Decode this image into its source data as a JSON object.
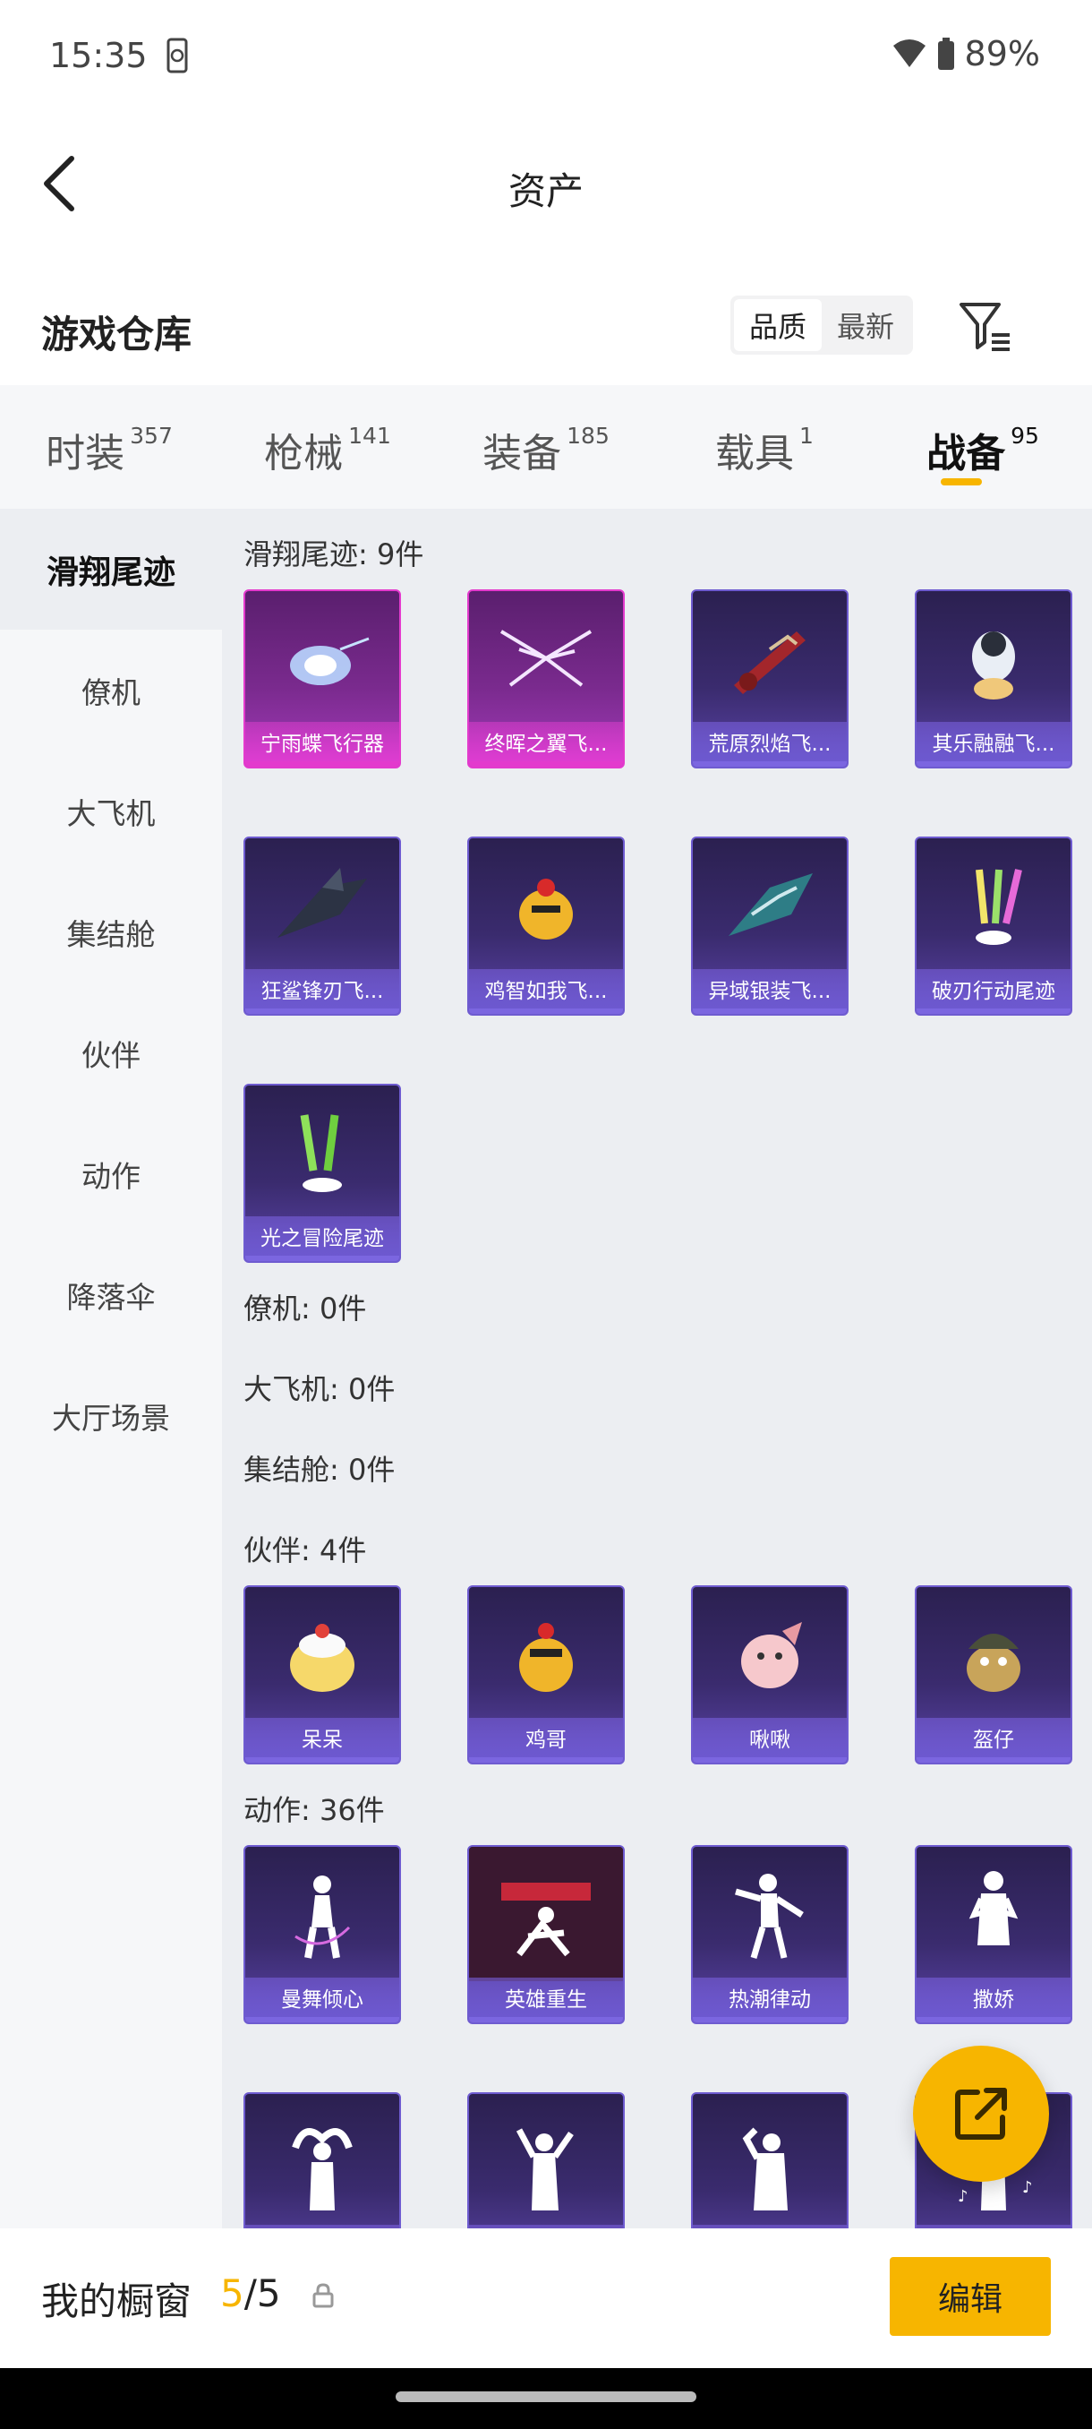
{
  "status_bar": {
    "time": "15:35",
    "battery": "89%"
  },
  "header": {
    "title": "资产"
  },
  "warehouse": {
    "title": "游戏仓库",
    "sort_options": [
      "品质",
      "最新"
    ],
    "sort_active": "品质"
  },
  "category_tabs": [
    {
      "label": "时装",
      "count": "357"
    },
    {
      "label": "枪械",
      "count": "141"
    },
    {
      "label": "装备",
      "count": "185"
    },
    {
      "label": "载具",
      "count": "1"
    },
    {
      "label": "战备",
      "count": "95",
      "active": true
    }
  ],
  "sidebar": {
    "items": [
      "滑翔尾迹",
      "僚机",
      "大飞机",
      "集结舱",
      "伙伴",
      "动作",
      "降落伞",
      "大厅场景"
    ],
    "active": "滑翔尾迹"
  },
  "sections": [
    {
      "label": "滑翔尾迹: 9件",
      "items": [
        "宁雨蝶飞行器",
        "终晖之翼飞...",
        "荒原烈焰飞...",
        "其乐融融飞...",
        "狂鲨锋刃飞...",
        "鸡智如我飞...",
        "异域银装飞...",
        "破刃行动尾迹",
        "光之冒险尾迹"
      ]
    },
    {
      "label": "僚机: 0件",
      "items": []
    },
    {
      "label": "大飞机: 0件",
      "items": []
    },
    {
      "label": "集结舱: 0件",
      "items": []
    },
    {
      "label": "伙伴: 4件",
      "items": [
        "呆呆",
        "鸡哥",
        "啾啾",
        "盔仔"
      ]
    },
    {
      "label": "动作: 36件",
      "items": [
        "曼舞倾心",
        "英雄重生",
        "热潮律动",
        "撒娇",
        "",
        "",
        "",
        ""
      ]
    }
  ],
  "bottom_bar": {
    "showcase_label": "我的橱窗",
    "showcase_used": "5",
    "showcase_total": "/5",
    "edit_label": "编辑"
  },
  "colors": {
    "accent": "#f7b500",
    "card_purple": "#3a2b6e",
    "card_pink": "#e33acd"
  },
  "icons": [
    "phone-sync-icon",
    "wifi-icon",
    "battery-icon",
    "back-arrow-icon",
    "filter-icon",
    "share-icon",
    "lock-icon"
  ]
}
